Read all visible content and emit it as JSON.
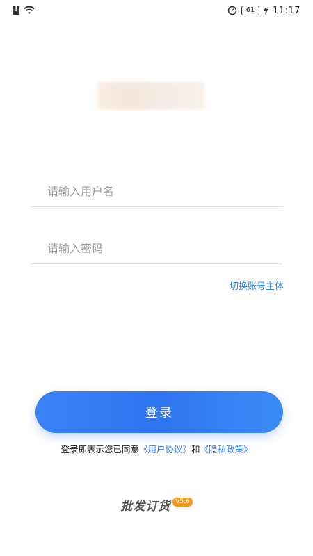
{
  "status_bar": {
    "battery": "61",
    "time": "11:17"
  },
  "login": {
    "username_placeholder": "请输入用户名",
    "password_placeholder": "请输入密码",
    "switch_account_label": "切换账号主体",
    "login_button_label": "登录"
  },
  "agreement": {
    "prefix": "登录即表示您已同意",
    "user_agreement": "《用户协议》",
    "and": "和",
    "privacy_policy": "《隐私政策》"
  },
  "footer": {
    "brand": "批发订货",
    "version": "V5.6"
  },
  "colors": {
    "accent": "#2f7ff2",
    "button_gradient_start": "#3a82f6",
    "button_gradient_end": "#3b8cf5",
    "version_badge": "#f29a25"
  },
  "icons": [
    "sim-alert-icon",
    "wifi-icon",
    "speedometer-icon",
    "battery-icon",
    "charging-icon"
  ]
}
